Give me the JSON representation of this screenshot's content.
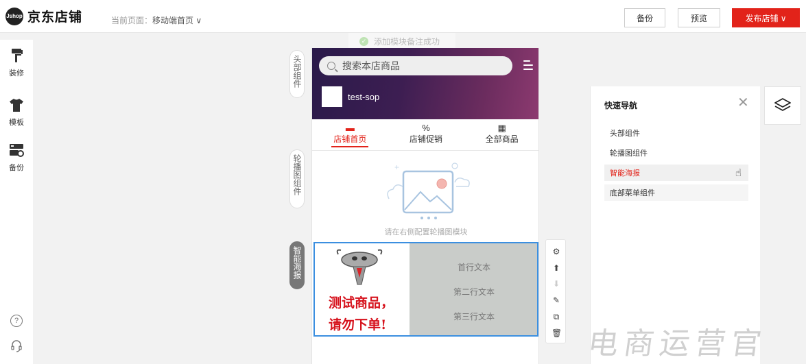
{
  "brand": {
    "mark": "Jshop",
    "name": "京东店铺"
  },
  "top": {
    "current_label": "当前页面：",
    "current_value": "移动端首页 ∨",
    "backup": "备份",
    "preview": "预览",
    "publish": "发布店铺 ∨"
  },
  "sidebar": {
    "items": [
      {
        "label": "装修",
        "icon": "paint-roller-icon"
      },
      {
        "label": "模板",
        "icon": "shirt-icon"
      },
      {
        "label": "备份",
        "icon": "backup-icon"
      }
    ],
    "help": "?",
    "support": "headset-icon"
  },
  "toast": "添加模块备注成功",
  "component_tabs": [
    {
      "label": "头部组件"
    },
    {
      "label": "轮播图组件"
    },
    {
      "label": "智能海报",
      "active": true
    }
  ],
  "store": {
    "search_placeholder": "搜索本店商品",
    "name": "test-sop",
    "nav": [
      {
        "icon": "▬",
        "label": "店铺首页",
        "active": true
      },
      {
        "icon": "%",
        "label": "店铺促销",
        "active": false
      },
      {
        "icon": "▦",
        "label": "全部商品",
        "active": false
      }
    ],
    "carousel_hint": "请在右侧配置轮播图模块",
    "poster": {
      "promo_line1": "测试商品，",
      "promo_line2": "请勿下单!",
      "text1": "首行文本",
      "text2": "第二行文本",
      "text3": "第三行文本"
    }
  },
  "tools": [
    "⚙",
    "⬆",
    "⬇",
    "✎",
    "⧉",
    "🗑"
  ],
  "quick_nav": {
    "title": "快速导航",
    "close": "✕",
    "items": [
      "头部组件",
      "轮播图组件",
      "智能海报",
      "底部菜单组件"
    ]
  },
  "watermark": "电商运营官",
  "colors": {
    "accent": "#e2231a",
    "selection": "#3b8fe0"
  }
}
